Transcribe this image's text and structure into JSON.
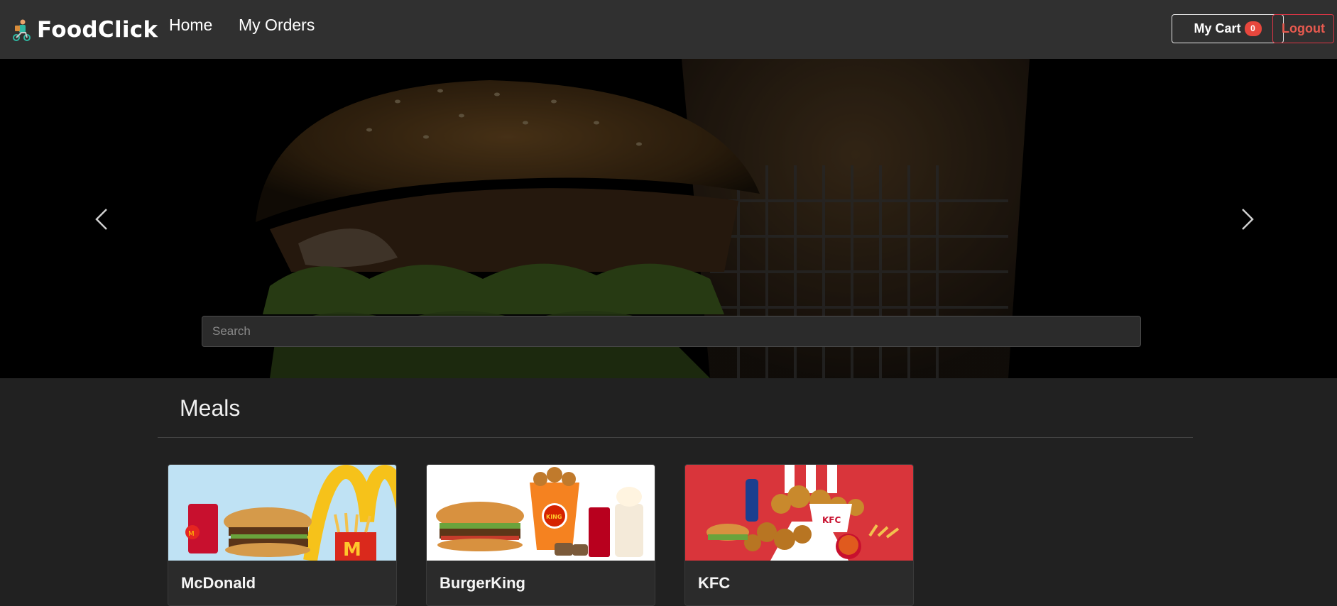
{
  "brand": {
    "name": "FoodClick",
    "logo_icon": "delivery-rider-icon"
  },
  "nav": {
    "home": "Home",
    "orders": "My Orders"
  },
  "cart": {
    "label": "My Cart",
    "count": "0"
  },
  "logout": {
    "label": "Logout"
  },
  "hero": {
    "search_placeholder": "Search"
  },
  "meals": {
    "title": "Meals",
    "cards": [
      {
        "title": "McDonald"
      },
      {
        "title": "BurgerKing"
      },
      {
        "title": "KFC"
      }
    ]
  },
  "colors": {
    "navbar": "#303030",
    "background": "#212121",
    "badge": "#e8473d",
    "logout": "#dc3545",
    "kfc_red": "#d9353b"
  }
}
